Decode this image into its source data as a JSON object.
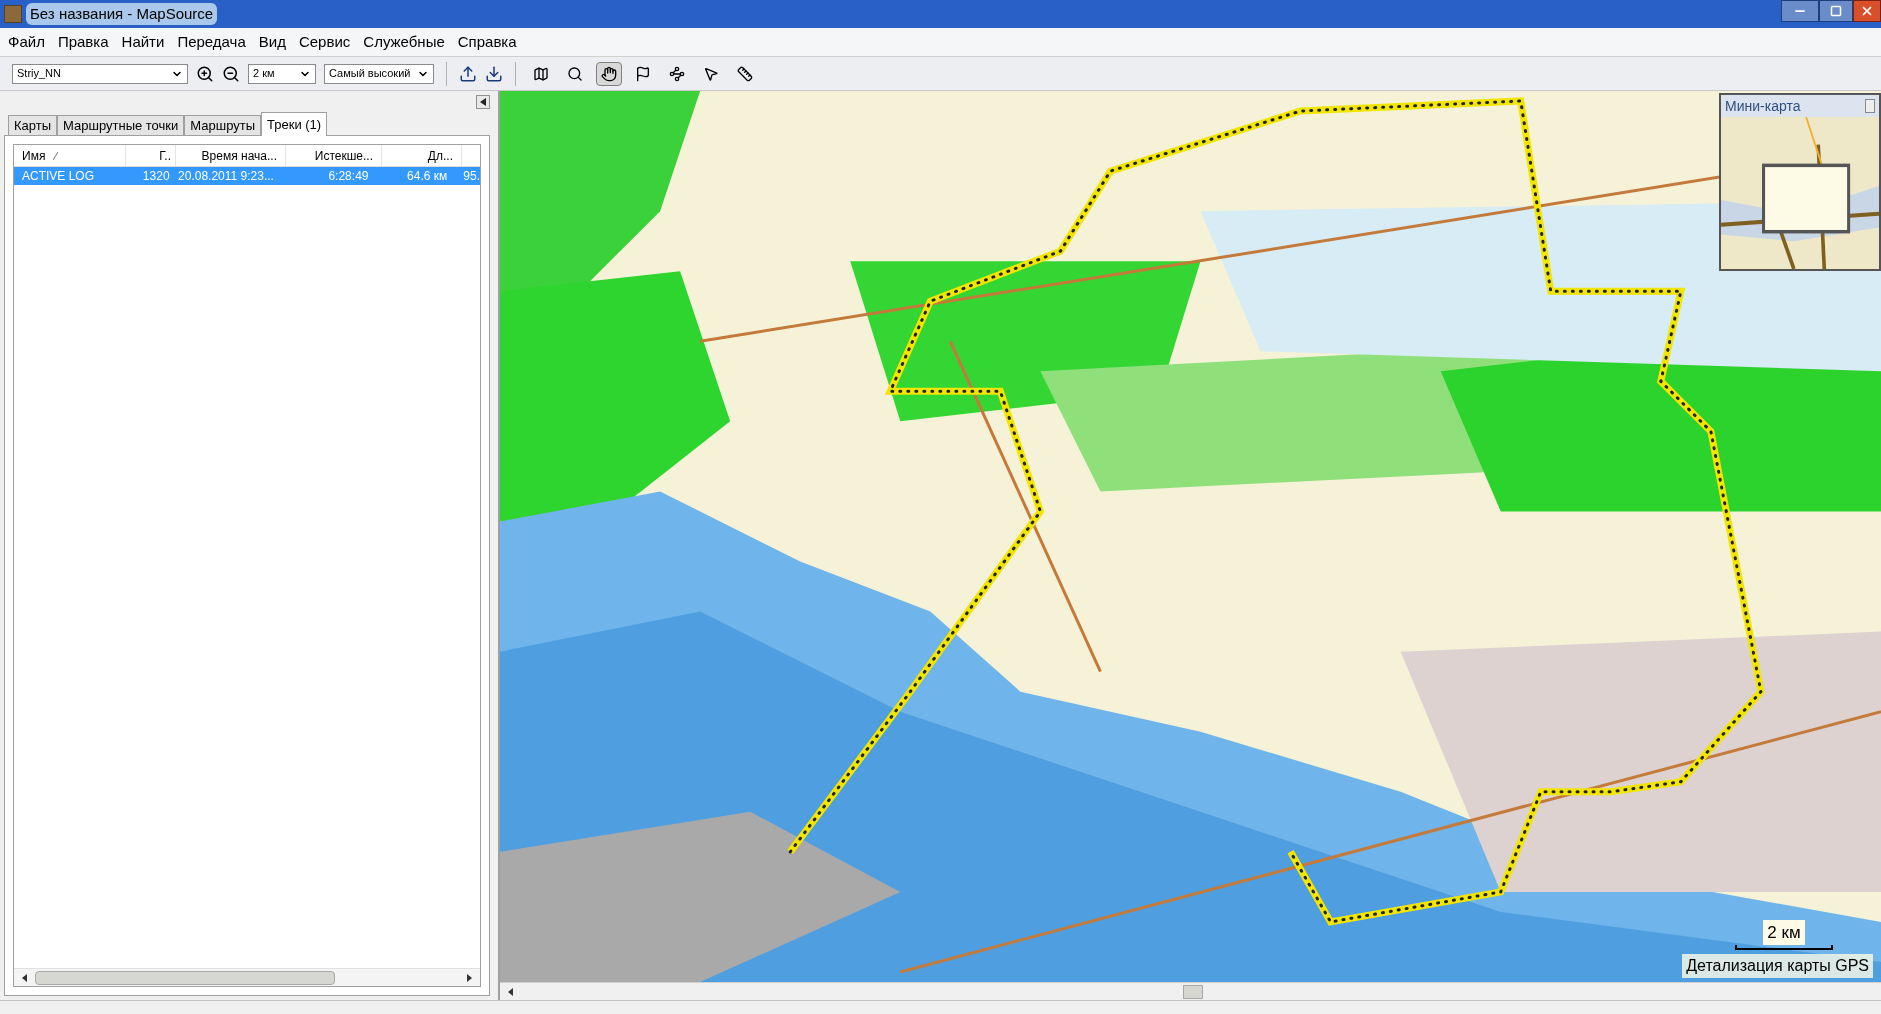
{
  "window": {
    "title": "Без названия - MapSource"
  },
  "menu": [
    "Файл",
    "Правка",
    "Найти",
    "Передача",
    "Вид",
    "Сервис",
    "Служебные",
    "Справка"
  ],
  "toolbar": {
    "map_product": "Striy_NN",
    "zoom": "2 км",
    "detail": "Самый высокий",
    "tools": [
      {
        "kind": "select-map",
        "selected": false
      },
      {
        "kind": "zoom",
        "selected": false
      },
      {
        "kind": "hand",
        "selected": true
      },
      {
        "kind": "waypoint",
        "selected": false
      },
      {
        "kind": "route",
        "selected": false
      },
      {
        "kind": "pointer",
        "selected": false
      },
      {
        "kind": "distance",
        "selected": false
      }
    ]
  },
  "tabs": [
    {
      "label": "Карты",
      "selected": false
    },
    {
      "label": "Маршрутные точки",
      "selected": false
    },
    {
      "label": "Маршруты",
      "selected": false
    },
    {
      "label": "Треки (1)",
      "selected": true
    }
  ],
  "table": {
    "columns": [
      {
        "label": "Имя",
        "sorted": true
      },
      {
        "label": "Г..",
        "sorted": false
      },
      {
        "label": "Время нача...",
        "sorted": false
      },
      {
        "label": "Истекше...",
        "sorted": false
      },
      {
        "label": "Дл...",
        "sorted": false
      }
    ],
    "rows": [
      {
        "cells": [
          "ACTIVE LOG",
          "1320",
          "20.08.2011 9:23...",
          "6:28:49",
          "64.6 км",
          "95."
        ],
        "selected": true
      }
    ]
  },
  "map": {
    "scale": "2 км",
    "detail_label": "Детализация карты GPS",
    "minimap": {
      "title": "Мини-карта"
    }
  }
}
